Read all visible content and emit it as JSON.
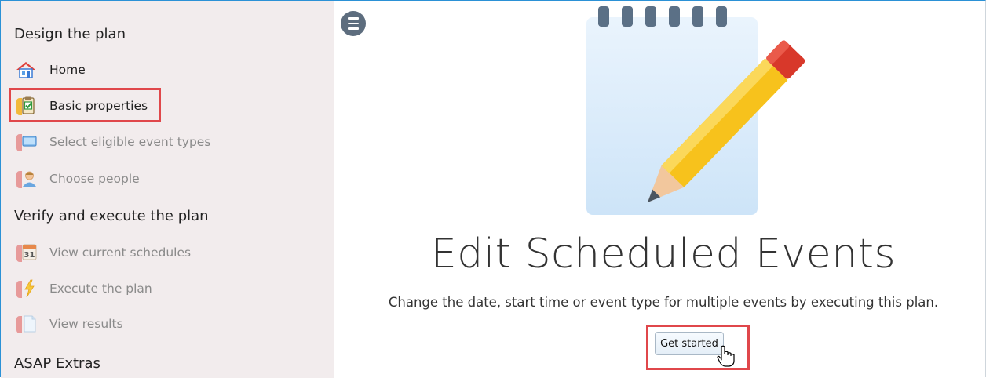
{
  "sidebar": {
    "sections": [
      {
        "title": "Design the plan"
      },
      {
        "title": "Verify and execute the plan"
      },
      {
        "title": "ASAP Extras"
      }
    ],
    "items": [
      {
        "label": "Home",
        "icon": "home-icon"
      },
      {
        "label": "Basic properties",
        "icon": "clipboard-check-icon"
      },
      {
        "label": "Select eligible event types",
        "icon": "monitor-icon"
      },
      {
        "label": "Choose people",
        "icon": "person-icon"
      },
      {
        "label": "View current schedules",
        "icon": "calendar-icon",
        "calendar_day": "31"
      },
      {
        "label": "Execute the plan",
        "icon": "lightning-icon"
      },
      {
        "label": "View results",
        "icon": "document-icon"
      }
    ]
  },
  "main": {
    "title": "Edit Scheduled Events",
    "subtitle": "Change the date, start time or event type for multiple events by executing this plan.",
    "get_started_label": "Get started"
  },
  "colors": {
    "highlight": "#e0474b",
    "sidebar_bg": "#f2eced",
    "accent_border": "#2b91d6"
  }
}
